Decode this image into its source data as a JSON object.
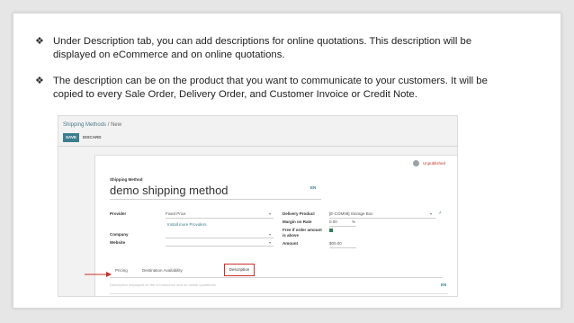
{
  "bullets": [
    {
      "marker": "❖",
      "text": "Under Description tab, you can add descriptions for online quotations. This description will be displayed on eCommerce and on online quotations."
    },
    {
      "marker": "❖",
      "text": "The description can be on the product that you want to communicate to your customers. It will be copied to every Sale Order, Delivery Order, and Customer Invoice or Credit Note."
    }
  ],
  "screenshot": {
    "breadcrumb": {
      "parent": "Shipping Methods",
      "separator": " / ",
      "current": "New"
    },
    "buttons": {
      "save": "SAVE",
      "discard": "DISCARD"
    },
    "status": "Unpublished",
    "shipping_method_label": "Shipping Method",
    "shipping_method_value": "demo shipping method",
    "lang": "EN",
    "left_fields": {
      "provider_label": "Provider",
      "provider_value": "Fixed Price",
      "install_link": "Install more Providers",
      "company_label": "Company",
      "website_label": "Website"
    },
    "right_fields": {
      "delivery_product_label": "Delivery Product",
      "delivery_product_value": "[E-COM08] Storage Box",
      "margin_label": "Margin on Rate",
      "margin_value": "0.00",
      "margin_unit": "%",
      "free_label": "Free if order amount is above",
      "amount_label": "Amount",
      "amount_value": "$00.00"
    },
    "tabs": [
      "Pricing",
      "Destination Availability",
      "Description"
    ],
    "active_tab": "Description",
    "description_placeholder": "Description displayed on the eCommerce and on online quotations.",
    "annotation_color": "#c8302c"
  },
  "colors": {
    "accent": "#3c7e8e",
    "highlight": "#c8302c",
    "checkbox": "#2e7d5b"
  }
}
